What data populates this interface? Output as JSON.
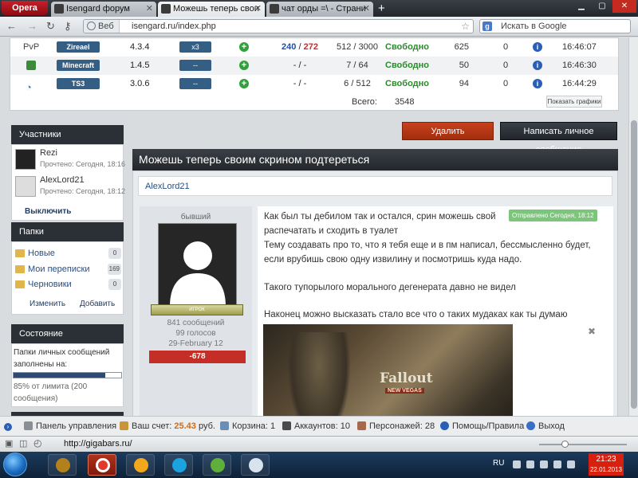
{
  "browser": {
    "menu_label": "Opera",
    "tabs": [
      {
        "title": "Isengard форум"
      },
      {
        "title": "Можешь теперь свои"
      },
      {
        "title": "чат орды =\\ - Страни"
      }
    ],
    "site_label": "Веб",
    "url": "isengard.ru/index.php",
    "search_placeholder": "Искать в Google",
    "status_url": "http://gigabars.ru/"
  },
  "servers": {
    "rows": [
      {
        "name": "PvP",
        "tag": "Zireael",
        "version": "4.3.4",
        "mod": "x3",
        "ping_a": "240",
        "ping_b": "272",
        "slots": "512 / 3000",
        "status": "Свободно",
        "count": "625",
        "zero": "0",
        "time": "16:46:07"
      },
      {
        "name": "",
        "tag": "Minecraft",
        "version": "1.4.5",
        "mod": "--",
        "ping": "- / -",
        "slots": "7 / 64",
        "status": "Свободно",
        "count": "50",
        "zero": "0",
        "time": "16:46:30"
      },
      {
        "name": "",
        "tag": "TS3",
        "version": "3.0.6",
        "mod": "--",
        "ping": "- / -",
        "slots": "6 / 512",
        "status": "Свободно",
        "count": "94",
        "zero": "0",
        "time": "16:44:29"
      }
    ],
    "total_label": "Всего:",
    "total_value": "3548",
    "graph_button": "Показать графики"
  },
  "sidebar": {
    "members_title": "Участники",
    "members": [
      {
        "name": "Rezi",
        "read": "Прочтено: Сегодня, 18:16"
      },
      {
        "name": "AlexLord21",
        "read": "Прочтено: Сегодня, 18:12"
      }
    ],
    "exclude_label": "Выключить",
    "folders_title": "Папки",
    "folders": [
      {
        "label": "Новые",
        "count": "0"
      },
      {
        "label": "Мои переписки",
        "count": "169"
      },
      {
        "label": "Черновики",
        "count": "0"
      }
    ],
    "edit_label": "Изменить",
    "add_label": "Добавить",
    "state_title": "Состояние",
    "state_text_1": "Папки личных сообщений",
    "state_text_2": "заполнены на:",
    "quota_fraction": 0.85,
    "quota_text_1": "85% от лимита (200",
    "quota_text_2": "сообщения)"
  },
  "actions": {
    "delete_label": "Удалить",
    "pm_label": "Написать личное сообщение"
  },
  "topic": {
    "title": "Можешь теперь своим скрином подтереться",
    "author": "AlexLord21",
    "rank": "бывший",
    "rank_badge": "ИГРОК",
    "messages": "841 сообщений",
    "votes": "99 голосов",
    "joined": "29-February 12",
    "reputation": "-678",
    "sent_label": "Отправлено Сегодня, 18:12",
    "lines": [
      "Как был ты дебилом так и остался, срин можешь свой",
      "распечатать и сходить в туалет",
      "Тему создавать про то, что я тебя еще и в пм написал, бессмысленно будет,",
      "если врубишь свою одну извилину и посмотришь куда надо.",
      "Такого тупорылого морального дегенерата давно не видел",
      "Наконец можно высказать стало все что о таких мудаках как ты думаю"
    ],
    "image_title": "Fallout",
    "image_subtitle": "NEW VEGAS"
  },
  "sitebar": {
    "panel": "Панель управления",
    "balance_label": "Ваш счет:",
    "balance_value": "25.43",
    "balance_unit": "руб.",
    "cart_label": "Корзина:",
    "cart_value": "1",
    "accounts_label": "Аккаунтов:",
    "accounts_value": "10",
    "chars_label": "Персонажей:",
    "chars_value": "28",
    "help": "Помощь/Правила",
    "exit": "Выход"
  },
  "taskbar": {
    "lang": "RU",
    "time": "21:23",
    "date": "22.01.2013"
  }
}
